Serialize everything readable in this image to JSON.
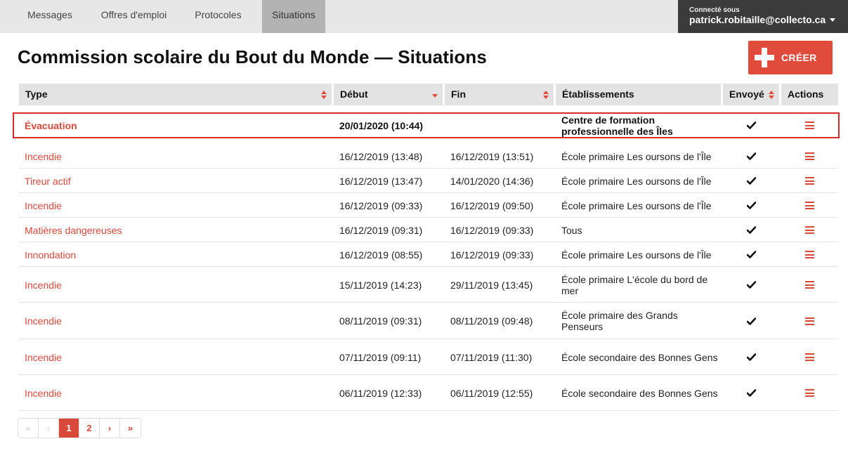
{
  "nav": {
    "tabs": [
      {
        "label": "Messages"
      },
      {
        "label": "Offres d'emploi"
      },
      {
        "label": "Protocoles"
      },
      {
        "label": "Situations"
      }
    ],
    "active_tab": "Situations"
  },
  "user": {
    "caption": "Connecté sous",
    "email": "patrick.robitaille@collecto.ca"
  },
  "page": {
    "title": "Commission scolaire du Bout du Monde — Situations",
    "create_label": "CRÉER"
  },
  "table": {
    "headers": {
      "type": "Type",
      "debut": "Début",
      "fin": "Fin",
      "etablissements": "Établissements",
      "envoye": "Envoyé",
      "actions": "Actions"
    },
    "rows": [
      {
        "type": "Évacuation",
        "debut": "20/01/2020 (10:44)",
        "fin": "",
        "etab": "Centre de formation professionnelle des Îles",
        "envoye": true,
        "highlighted": true
      },
      {
        "type": "Incendie",
        "debut": "16/12/2019 (13:48)",
        "fin": "16/12/2019 (13:51)",
        "etab": "École primaire Les oursons de l'Île",
        "envoye": true
      },
      {
        "type": "Tireur actif",
        "debut": "16/12/2019 (13:47)",
        "fin": "14/01/2020 (14:36)",
        "etab": "École primaire Les oursons de l'Île",
        "envoye": true
      },
      {
        "type": "Incendie",
        "debut": "16/12/2019 (09:33)",
        "fin": "16/12/2019 (09:50)",
        "etab": "École primaire Les oursons de l'Île",
        "envoye": true
      },
      {
        "type": "Matières dangereuses",
        "debut": "16/12/2019 (09:31)",
        "fin": "16/12/2019 (09:33)",
        "etab": "Tous",
        "envoye": true
      },
      {
        "type": "Innondation",
        "debut": "16/12/2019 (08:55)",
        "fin": "16/12/2019 (09:33)",
        "etab": "École primaire Les oursons de l'Île",
        "envoye": true
      },
      {
        "type": "Incendie",
        "debut": "15/11/2019 (14:23)",
        "fin": "29/11/2019 (13:45)",
        "etab": "École primaire L'école du bord de mer",
        "envoye": true
      },
      {
        "type": "Incendie",
        "debut": "08/11/2019 (09:31)",
        "fin": "08/11/2019 (09:48)",
        "etab": "École primaire des Grands Penseurs",
        "envoye": true
      },
      {
        "type": "Incendie",
        "debut": "07/11/2019 (09:11)",
        "fin": "07/11/2019 (11:30)",
        "etab": "École secondaire des Bonnes Gens",
        "envoye": true
      },
      {
        "type": "Incendie",
        "debut": "06/11/2019 (12:33)",
        "fin": "06/11/2019 (12:55)",
        "etab": "École secondaire des Bonnes Gens",
        "envoye": true
      }
    ]
  },
  "pagination": {
    "first": "«",
    "prev": "‹",
    "pages": [
      "1",
      "2"
    ],
    "current": "1",
    "next": "›",
    "last": "»"
  },
  "colors": {
    "accent": "#d9493a",
    "highlight_border": "#d82a2a",
    "topbar": "#e7e7e7",
    "user_box": "#3b3b3b"
  }
}
